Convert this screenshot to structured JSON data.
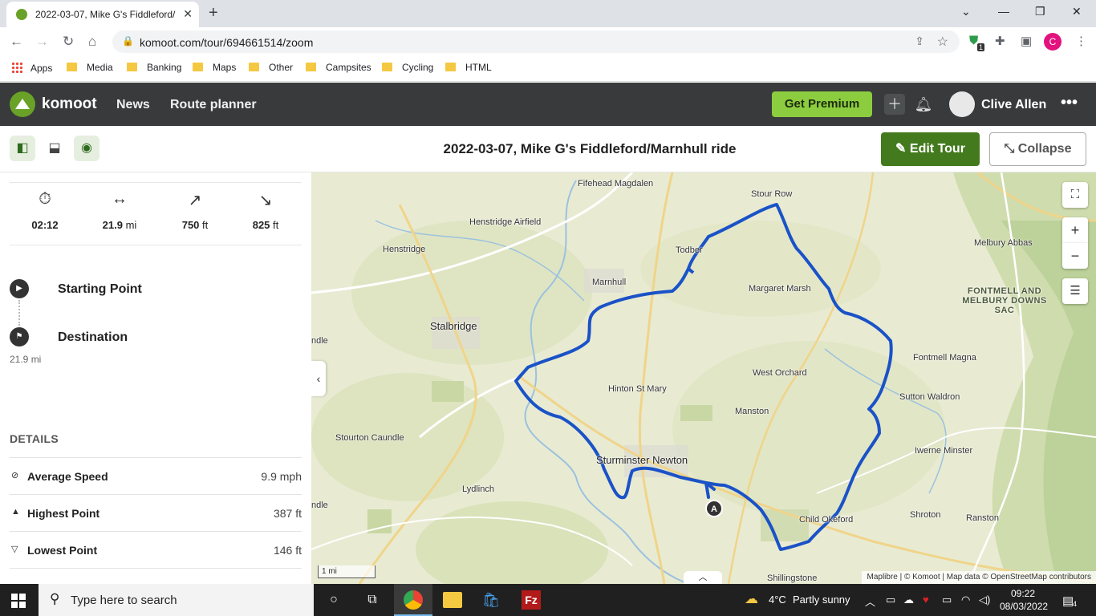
{
  "browser": {
    "tab_title": "2022-03-07, Mike G's Fiddleford/",
    "tab_close": "✕",
    "new_tab": "+",
    "url": "komoot.com/tour/694661514/zoom",
    "extension_badge": "1",
    "profile_initial": "C",
    "window_minimize": "—",
    "window_restore": "❐",
    "window_close": "✕"
  },
  "bookmarks": [
    {
      "label": "Apps"
    },
    {
      "label": "Media"
    },
    {
      "label": "Banking"
    },
    {
      "label": "Maps"
    },
    {
      "label": "Other"
    },
    {
      "label": "Campsites"
    },
    {
      "label": "Cycling"
    },
    {
      "label": "HTML"
    }
  ],
  "komoot": {
    "brand": "komoot",
    "nav": [
      "News",
      "Route planner"
    ],
    "premium_label": "Get Premium",
    "user_name": "Clive Allen"
  },
  "tour": {
    "title": "2022-03-07, Mike G's Fiddleford/Marnhull ride",
    "edit_label": "Edit Tour",
    "collapse_label": "Collapse"
  },
  "stats": [
    {
      "icon": "stopwatch-icon",
      "value": "02:12",
      "unit": ""
    },
    {
      "icon": "distance-icon",
      "value": "21.9",
      "unit": " mi"
    },
    {
      "icon": "uphill-icon",
      "value": "750",
      "unit": " ft"
    },
    {
      "icon": "downhill-icon",
      "value": "825",
      "unit": " ft"
    }
  ],
  "waypoints": {
    "start_label": "Starting Point",
    "destination_label": "Destination",
    "destination_distance": "21.9 mi"
  },
  "details": {
    "heading": "DETAILS",
    "rows": [
      {
        "label": "Average Speed",
        "value": "9.9 mph"
      },
      {
        "label": "Highest Point",
        "value": "387 ft"
      },
      {
        "label": "Lowest Point",
        "value": "146 ft"
      }
    ]
  },
  "map": {
    "places": [
      "Fifehead Magdalen",
      "Stour Row",
      "Henstridge Airfield",
      "Melbury Abbas",
      "Henstridge",
      "Todber",
      "Marnhull",
      "Margaret Marsh",
      "FONTMELL AND MELBURY DOWNS SAC",
      "Stalbridge",
      "Fontmell Magna",
      "West Orchard",
      "Hinton St Mary",
      "Sutton Waldron",
      "Manston",
      "Stourton Caundle",
      "Sturminster Newton",
      "Iwerne Minster",
      "Lydlinch",
      "Shroton",
      "Ranston",
      "Child Okeford",
      "Shillingstone",
      "ndle",
      "ndle"
    ],
    "start_marker": "A",
    "scale_label": "1 mi",
    "attribution": "Maplibre | © Komoot | Map data © OpenStreetMap contributors",
    "route_color": "#1a52c7"
  },
  "taskbar": {
    "search_placeholder": "Type here to search",
    "weather_temp": "4°C",
    "weather_text": "Partly sunny",
    "time": "09:22",
    "date": "08/03/2022",
    "notification_count": "4"
  }
}
